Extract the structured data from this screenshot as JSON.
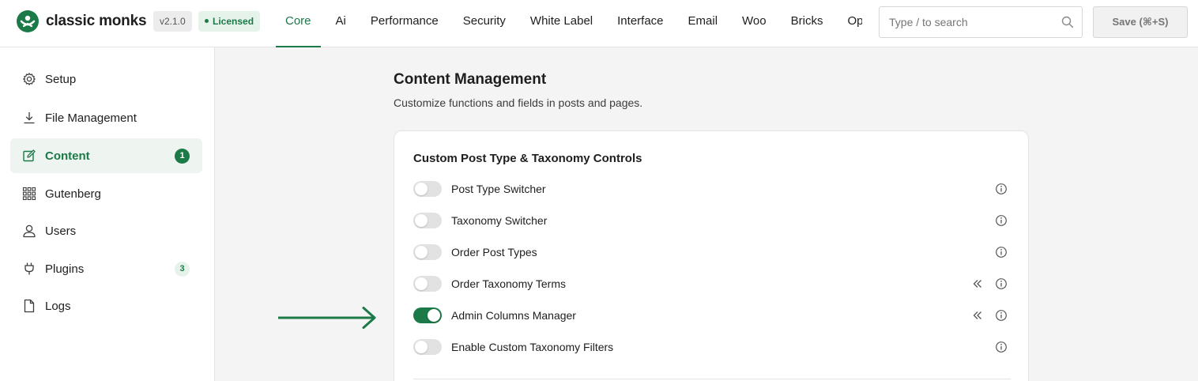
{
  "app": {
    "brand": "classic monks",
    "version": "v2.1.0",
    "license": "Licensed"
  },
  "nav": {
    "tabs": [
      {
        "label": "Core",
        "active": true
      },
      {
        "label": "Ai"
      },
      {
        "label": "Performance"
      },
      {
        "label": "Security"
      },
      {
        "label": "White Label"
      },
      {
        "label": "Interface"
      },
      {
        "label": "Email"
      },
      {
        "label": "Woo"
      },
      {
        "label": "Bricks"
      },
      {
        "label": "Opt"
      }
    ]
  },
  "search": {
    "placeholder": "Type / to search"
  },
  "save": {
    "label": "Save (⌘+S)"
  },
  "sidebar": {
    "items": [
      {
        "label": "Setup",
        "icon": "gear-icon"
      },
      {
        "label": "File Management",
        "icon": "download-icon"
      },
      {
        "label": "Content",
        "icon": "edit-icon",
        "active": true,
        "badge": "1"
      },
      {
        "label": "Gutenberg",
        "icon": "grid-icon"
      },
      {
        "label": "Users",
        "icon": "user-icon"
      },
      {
        "label": "Plugins",
        "icon": "plug-icon",
        "badge": "3"
      },
      {
        "label": "Logs",
        "icon": "file-icon"
      }
    ]
  },
  "main": {
    "title": "Content Management",
    "subtitle": "Customize functions and fields in posts and pages."
  },
  "card": {
    "title": "Custom Post Type & Taxonomy Controls",
    "rows": [
      {
        "label": "Post Type Switcher",
        "enabled": false,
        "collapse": false
      },
      {
        "label": "Taxonomy Switcher",
        "enabled": false,
        "collapse": false
      },
      {
        "label": "Order Post Types",
        "enabled": false,
        "collapse": false
      },
      {
        "label": "Order Taxonomy Terms",
        "enabled": false,
        "collapse": true
      },
      {
        "label": "Admin Columns Manager",
        "enabled": true,
        "collapse": true
      },
      {
        "label": "Enable Custom Taxonomy Filters",
        "enabled": false,
        "collapse": false
      }
    ]
  },
  "colors": {
    "accent": "#1b7a47",
    "accent_soft": "#e5f3ea",
    "toggle_off": "#e2e2e2"
  }
}
